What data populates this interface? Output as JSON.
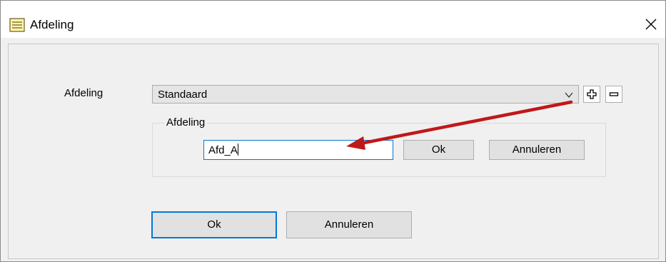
{
  "window": {
    "title": "Afdeling"
  },
  "form": {
    "afdeling_label": "Afdeling",
    "combo_value": "Standaard",
    "group_title": "Afdeling",
    "new_name_value": "Afd_A",
    "group_ok_label": "Ok",
    "group_cancel_label": "Annuleren"
  },
  "footer": {
    "ok_label": "Ok",
    "cancel_label": "Annuleren"
  },
  "icons": {
    "add": "plus-icon",
    "remove": "minus-icon",
    "close": "close-icon",
    "app": "document-icon",
    "dropdown": "chevron-down-icon"
  },
  "colors": {
    "accent": "#0078d7",
    "annotation_arrow": "#c0181a"
  }
}
